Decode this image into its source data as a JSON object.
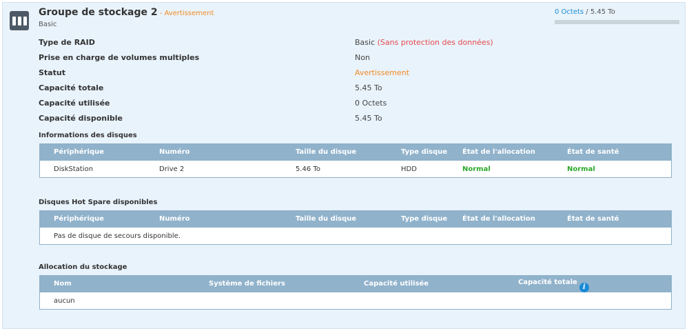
{
  "header": {
    "title": "Groupe de stockage 2",
    "separator": " - ",
    "status": "Avertissement",
    "subtitle": "Basic",
    "usage_used": "0 Octets",
    "usage_sep": " / ",
    "usage_total": "5.45 To",
    "usage_fraction": 0.0
  },
  "properties": [
    {
      "label": "Type de RAID",
      "value": "Basic",
      "note": "(Sans protection des données)"
    },
    {
      "label": "Prise en charge de volumes multiples",
      "value": "Non"
    },
    {
      "label": "Statut",
      "value": "Avertissement"
    },
    {
      "label": "Capacité totale",
      "value": "5.45 To"
    },
    {
      "label": "Capacité utilisée",
      "value": "0 Octets"
    },
    {
      "label": "Capacité disponible",
      "value": "5.45 To"
    }
  ],
  "disks": {
    "title": "Informations des disques",
    "columns": [
      "Périphérique",
      "Numéro",
      "Taille du disque",
      "Type disque",
      "État de l'allocation",
      "État de santé"
    ],
    "rows": [
      [
        "DiskStation",
        "Drive 2",
        "5.46 To",
        "HDD",
        "Normal",
        "Normal"
      ]
    ]
  },
  "hotspare": {
    "title": "Disques Hot Spare disponibles",
    "columns": [
      "Périphérique",
      "Numéro",
      "Taille du disque",
      "Type disque",
      "État de l'allocation",
      "État de santé"
    ],
    "empty": "Pas de disque de secours disponible."
  },
  "allocation": {
    "title": "Allocation du stockage",
    "columns": [
      "Nom",
      "Système de fichiers",
      "Capacité utilisée",
      "Capacité totale"
    ],
    "rows": [
      [
        "aucun"
      ]
    ]
  },
  "colors": {
    "warning": "#f08a24",
    "danger": "#e5484d",
    "healthy": "#2ca72c",
    "accent": "#1a8bd6",
    "table_header": "#90b2cb"
  }
}
